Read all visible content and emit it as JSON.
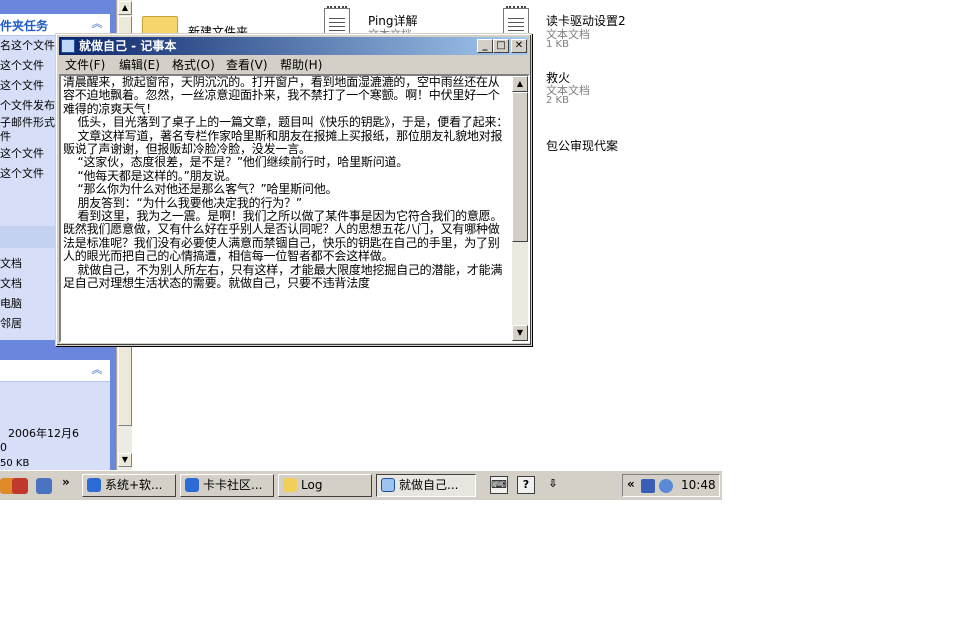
{
  "explorer": {
    "folder_tasks_title": "件夹任务",
    "folder_tasks": [
      "名这个文件",
      "这个文件",
      "这个文件",
      "个文件发布",
      "子邮件形式",
      "件",
      "这个文件",
      "这个文件"
    ],
    "other_places": [
      "文档",
      "文档",
      "电脑",
      "邻居"
    ],
    "details": {
      "date": "2006年12月6",
      "line2": "0",
      "size": "50 KB"
    },
    "files": [
      {
        "name": "新建文件夹",
        "type": "",
        "size": ""
      },
      {
        "name": "Ping详解",
        "type": "文本文档",
        "size": ""
      },
      {
        "name": "读卡驱动设置2",
        "type": "文本文档",
        "size": "1 KB"
      },
      {
        "name": "救火",
        "type": "文本文档",
        "size": "2 KB"
      },
      {
        "name": "包公审现代案",
        "type": "",
        "size": ""
      }
    ]
  },
  "notepad": {
    "title": "就做自己 - 记事本",
    "menu": [
      "文件(F)",
      "编辑(E)",
      "格式(O)",
      "查看(V)",
      "帮助(H)"
    ],
    "text": "清晨醒来，掀起窗帘，天阴沉沉的。打开窗户，看到地面湿漉漉的，空中雨丝还在从容不迫地飘着。忽然，一丝凉意迎面扑来，我不禁打了一个寒颤。啊！中伏里好一个难得的凉爽天气！\n    低头，目光落到了桌子上的一篇文章，题目叫《快乐的钥匙》，于是，便看了起来：\n    文章这样写道，著名专栏作家哈里斯和朋友在报摊上买报纸，那位朋友礼貌地对报贩说了声谢谢，但报贩却冷脸冷脸，没发一言。\n    “这家伙，态度很差，是不是？”他们继续前行时，哈里斯问道。\n    “他每天都是这样的。”朋友说。\n    “那么你为什么对他还是那么客气？”哈里斯问他。\n    朋友答到：“为什么我要他决定我的行为？”\n    看到这里，我为之一震。是啊！我们之所以做了某件事是因为它符合我们的意愿。既然我们愿意做，又有什么好在乎别人是否认同呢？人的思想五花八门，又有哪种做法是标准呢？我们没有必要使人满意而禁锢自己，快乐的钥匙在自己的手里，为了别人的眼光而把自己的心情搞遭，相信每一位智者都不会这样做。\n    就做自己，不为别人所左右，只有这样，才能最大限度地挖掘自己的潜能，才能满足自己对理想生活状态的需要。就做自己，只要不违背法度"
  },
  "taskbar": {
    "quicklaunch_more": "»",
    "buttons": [
      "系统+软...",
      "卡卡社区...",
      "Log",
      "就做自己..."
    ],
    "tray_more": "«",
    "clock": "10:48"
  }
}
